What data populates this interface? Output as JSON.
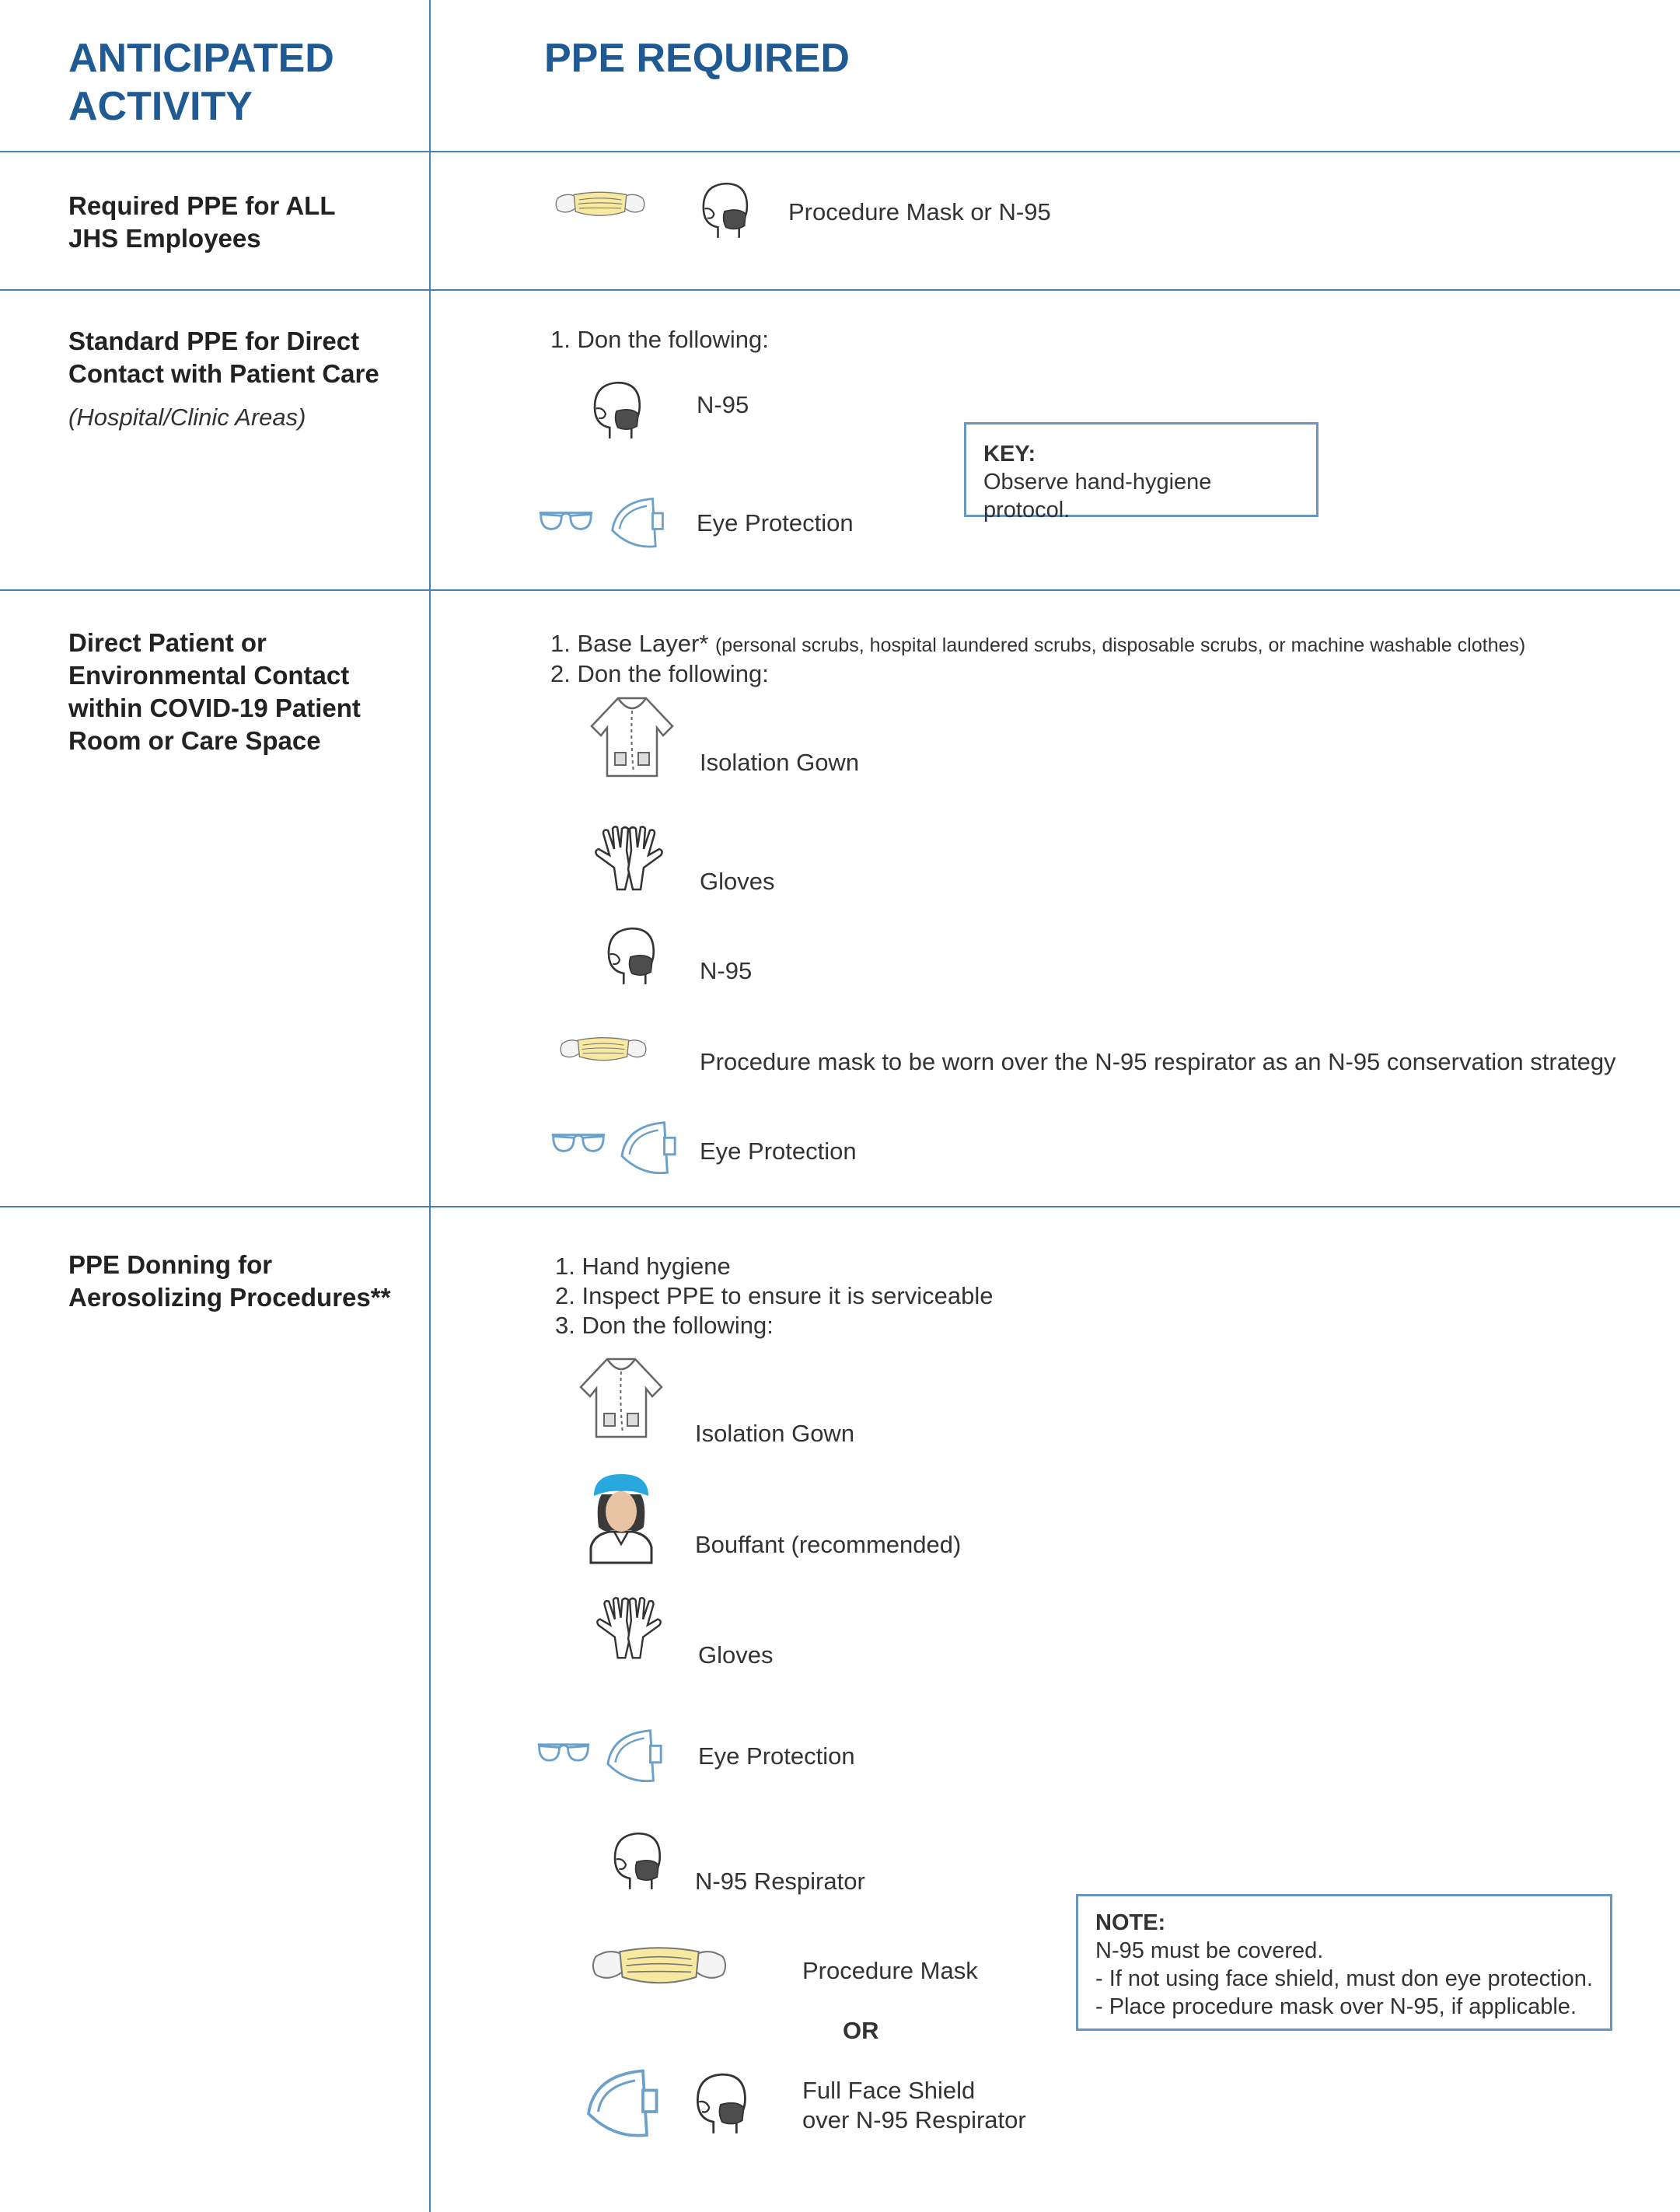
{
  "header": {
    "col1_line1": "ANTICIPATED",
    "col1_line2": "ACTIVITY",
    "col2": "PPE REQUIRED"
  },
  "rows": [
    {
      "activity": "Required PPE for ALL JHS Employees",
      "ppe_text": "Procedure Mask or N-95"
    },
    {
      "activity": "Standard PPE for Direct Contact with Patient Care",
      "activity_note": "(Hospital/Clinic Areas)",
      "step1": "1. Don the following:",
      "item_n95": "N-95",
      "item_eye": "Eye Protection",
      "key_title": "KEY:",
      "key_text": "Observe hand-hygiene protocol."
    },
    {
      "activity": "Direct Patient or Environmental Contact within COVID-19 Patient Room or Care Space",
      "step1_main": "1. Base Layer*",
      "step1_detail": "(personal scrubs, hospital laundered scrubs, disposable scrubs, or machine washable clothes)",
      "step2": "2. Don the following:",
      "item_gown": "Isolation Gown",
      "item_gloves": "Gloves",
      "item_n95": "N-95",
      "item_mask": "Procedure mask to be worn over the N-95 respirator as an N-95 conservation strategy",
      "item_eye": "Eye Protection"
    },
    {
      "activity": "PPE Donning for Aerosolizing Procedures**",
      "step1": "1.  Hand hygiene",
      "step2": "2.  Inspect PPE to ensure it is serviceable",
      "step3": "3.  Don the following:",
      "item_gown": "Isolation Gown",
      "item_bouffant": "Bouffant (recommended)",
      "item_gloves": "Gloves",
      "item_eye": "Eye Protection",
      "item_n95": "N-95 Respirator",
      "item_mask": "Procedure Mask",
      "or": "OR",
      "item_shield_l1": "Full Face Shield",
      "item_shield_l2": "over N-95 Respirator",
      "note_title": "NOTE:",
      "note_l1": "N-95 must be covered.",
      "note_l2": "- If not using face shield, must don eye protection.",
      "note_l3": "- Place procedure mask over N-95, if applicable."
    }
  ],
  "colors": {
    "header_blue": "#1f5a92",
    "rule_blue": "#4a7fb0",
    "mask_yellow": "#f7e9a0",
    "bouffant_blue": "#29a8e0",
    "skin": "#e9c4a4"
  },
  "icons": [
    "procedure-mask-icon",
    "n95-head-icon",
    "safety-glasses-icon",
    "face-shield-icon",
    "isolation-gown-icon",
    "gloves-icon",
    "bouffant-person-icon"
  ]
}
